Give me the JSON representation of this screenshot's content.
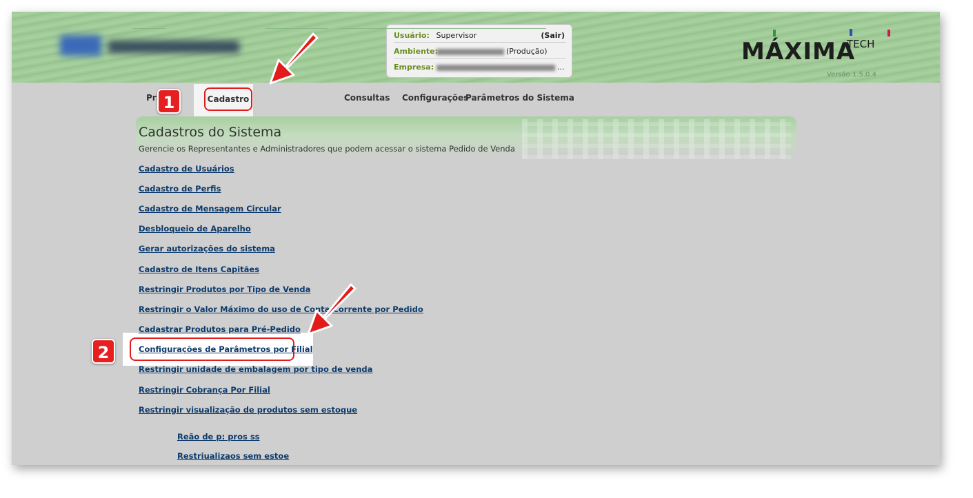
{
  "header": {
    "user_label": "Usuário:",
    "user_value": "Supervisor",
    "logout": "(Sair)",
    "env_label": "Ambiente:",
    "env_value": "(Produção)",
    "company_label": "Empresa:",
    "company_suffix": "...",
    "brand_name": "MÁXIMA",
    "brand_tech": "TECH",
    "version": "Versão 1.5.0.4"
  },
  "tabs": {
    "principal": "Pri",
    "cadastro": "Cadastro",
    "consultas": "Consultas",
    "configuracoes": "Configurações",
    "parametros": "Parâmetros do Sistema"
  },
  "steps": {
    "one": "1",
    "two": "2"
  },
  "panel": {
    "title": "Cadastros do Sistema",
    "subtitle": "Gerencie os Representantes e Administradores que podem acessar o sistema Pedido de Venda"
  },
  "links": [
    "Cadastro de Usuários",
    "Cadastro de Perfis",
    "Cadastro de Mensagem Circular",
    "Desbloqueio de Aparelho",
    "Gerar autorizações do sistema",
    "Cadastro de Itens Capitães",
    "Restringir Produtos por Tipo de Venda",
    "Restringir o Valor Máximo do uso de Conta Corrente por Pedido",
    "Cadastrar Produtos para Pré-Pedido",
    "Configurações de Parâmetros por Filial",
    "Restringir unidade de embalagem por tipo de venda",
    "Restringir Cobrança Por Filial",
    "Restringir visualização de produtos sem estoque"
  ],
  "ghost_links": [
    "Reão de p: pros ss",
    "Restriualizaos sem estoe"
  ],
  "colors": {
    "header_green": "#a9d1a0",
    "link_blue": "#0c3a6b",
    "highlight_red": "#e21b1b",
    "label_green": "#6b8e23"
  }
}
